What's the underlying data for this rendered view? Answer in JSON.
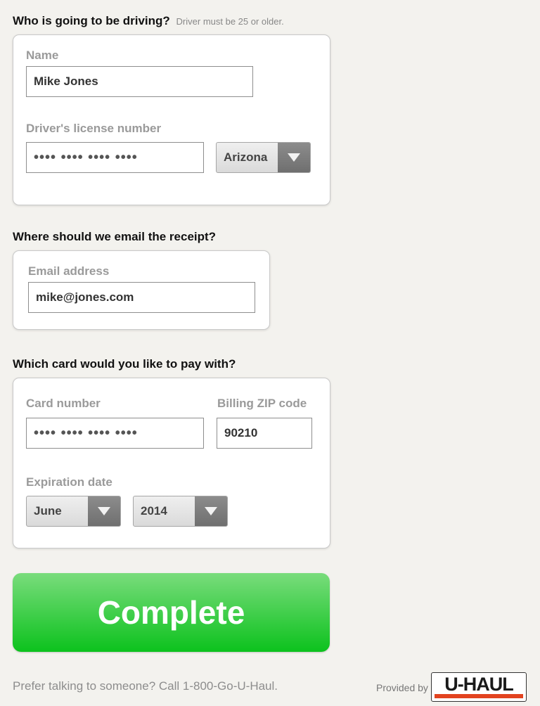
{
  "driver": {
    "heading": "Who is going to be driving?",
    "note": "Driver must be 25 or older.",
    "name_label": "Name",
    "name_value": "Mike Jones",
    "license_label": "Driver's license number",
    "license_value": "•••• •••• •••• ••••",
    "state_value": "Arizona"
  },
  "email": {
    "heading": "Where should we email the receipt?",
    "label": "Email address",
    "value": "mike@jones.com"
  },
  "payment": {
    "heading": "Which card would you like to pay with?",
    "card_label": "Card number",
    "card_value": "•••• •••• •••• ••••",
    "zip_label": "Billing ZIP code",
    "zip_value": "90210",
    "exp_label": "Expiration date",
    "exp_month": "June",
    "exp_year": "2014"
  },
  "actions": {
    "complete_label": "Complete"
  },
  "footer": {
    "call_text": "Prefer talking to someone? Call 1-800-Go-U-Haul.",
    "provided_by": "Provided by",
    "logo_text": "U-HAUL"
  },
  "colors": {
    "background": "#f3f2ee",
    "complete_button": "#0cc21d",
    "brand_accent": "#e2431f"
  },
  "icons": {
    "dropdown": "chevron-down-icon"
  }
}
